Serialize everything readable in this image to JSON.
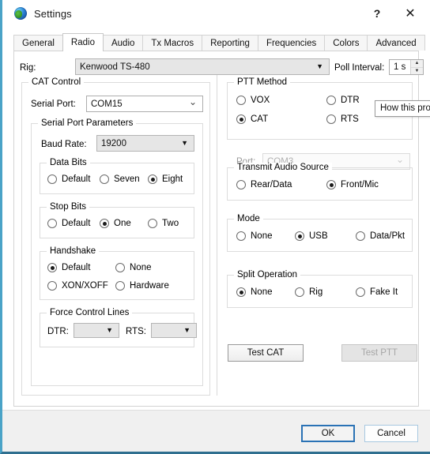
{
  "window": {
    "title": "Settings",
    "icon": "globe-icon",
    "help_label": "?",
    "close_label": "✕"
  },
  "tabs": [
    {
      "label": "General",
      "selected": false
    },
    {
      "label": "Radio",
      "selected": true
    },
    {
      "label": "Audio",
      "selected": false
    },
    {
      "label": "Tx Macros",
      "selected": false
    },
    {
      "label": "Reporting",
      "selected": false
    },
    {
      "label": "Frequencies",
      "selected": false
    },
    {
      "label": "Colors",
      "selected": false
    },
    {
      "label": "Advanced",
      "selected": false
    }
  ],
  "rig": {
    "label": "Rig:",
    "value": "Kenwood TS-480",
    "arrow": "▼"
  },
  "poll_interval": {
    "label": "Poll Interval:",
    "value": "1 s",
    "up": "▲",
    "down": "▼"
  },
  "cat_control": {
    "title": "CAT Control",
    "serial_port": {
      "label": "Serial Port:",
      "value": "COM15",
      "arrow": "⌄"
    },
    "serial_params": {
      "title": "Serial Port Parameters",
      "baud_rate": {
        "label": "Baud Rate:",
        "value": "19200",
        "arrow": "▼"
      },
      "data_bits": {
        "title": "Data Bits",
        "options": [
          {
            "label": "Default",
            "selected": false
          },
          {
            "label": "Seven",
            "selected": false
          },
          {
            "label": "Eight",
            "selected": true
          }
        ]
      },
      "stop_bits": {
        "title": "Stop Bits",
        "options": [
          {
            "label": "Default",
            "selected": false
          },
          {
            "label": "One",
            "selected": true
          },
          {
            "label": "Two",
            "selected": false
          }
        ]
      },
      "handshake": {
        "title": "Handshake",
        "options": [
          {
            "label": "Default",
            "selected": true
          },
          {
            "label": "None",
            "selected": false
          },
          {
            "label": "XON/XOFF",
            "selected": false
          },
          {
            "label": "Hardware",
            "selected": false
          }
        ]
      },
      "force_control_lines": {
        "title": "Force Control Lines",
        "dtr": {
          "label": "DTR:",
          "value": "",
          "arrow": "▼"
        },
        "rts": {
          "label": "RTS:",
          "value": "",
          "arrow": "▼"
        }
      }
    }
  },
  "ptt_method": {
    "title": "PTT Method",
    "options": [
      {
        "label": "VOX",
        "selected": false
      },
      {
        "label": "DTR",
        "selected": false
      },
      {
        "label": "CAT",
        "selected": true
      },
      {
        "label": "RTS",
        "selected": false
      }
    ],
    "port": {
      "label": "Port:",
      "value": "COM3",
      "arrow": "⌄",
      "disabled": true
    }
  },
  "transmit_audio_source": {
    "title": "Transmit Audio Source",
    "options": [
      {
        "label": "Rear/Data",
        "selected": false
      },
      {
        "label": "Front/Mic",
        "selected": true
      }
    ]
  },
  "mode": {
    "title": "Mode",
    "options": [
      {
        "label": "None",
        "selected": false
      },
      {
        "label": "USB",
        "selected": true
      },
      {
        "label": "Data/Pkt",
        "selected": false
      }
    ]
  },
  "split_operation": {
    "title": "Split Operation",
    "options": [
      {
        "label": "None",
        "selected": true
      },
      {
        "label": "Rig",
        "selected": false
      },
      {
        "label": "Fake It",
        "selected": false
      }
    ]
  },
  "test_buttons": {
    "test_cat": "Test CAT",
    "test_ptt": "Test PTT"
  },
  "tooltip": {
    "text": "How this prog"
  },
  "dialog_buttons": {
    "ok": "OK",
    "cancel": "Cancel"
  },
  "colors": {
    "accent": "#2a72b5",
    "window_bg": "#ffffff",
    "panel_bg": "#f0f0f0",
    "border": "#d3d3d3",
    "disabled_text": "#a6a6a6",
    "left_edge": "#4aa3c7"
  }
}
